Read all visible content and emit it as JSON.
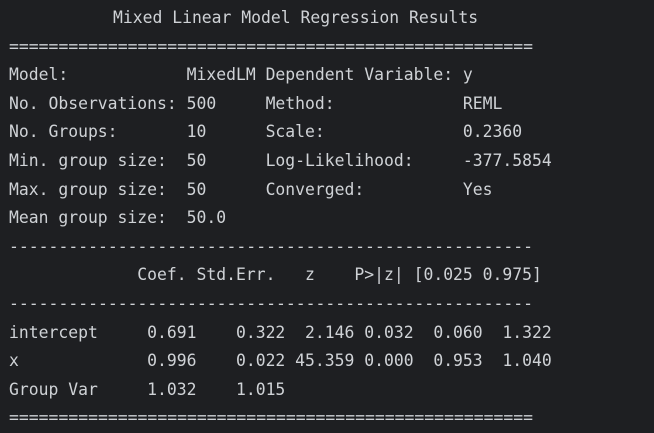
{
  "title": "Mixed Linear Model Regression Results",
  "rule_double": "=====================================================",
  "rule_single": "-----------------------------------------------------",
  "summary_rows": [
    "Model:            MixedLM Dependent Variable: y",
    "No. Observations: 500     Method:             REML",
    "No. Groups:       10      Scale:              0.2360",
    "Min. group size:  50      Log-Likelihood:     -377.5854",
    "Max. group size:  50      Converged:          Yes",
    "Mean group size:  50.0"
  ],
  "coef_header": "             Coef. Std.Err.   z    P>|z| [0.025 0.975]",
  "coef_rows": [
    "intercept     0.691    0.322  2.146 0.032  0.060  1.322",
    "x             0.996    0.022 45.359 0.000  0.953  1.040",
    "Group Var     1.032    1.015"
  ]
}
